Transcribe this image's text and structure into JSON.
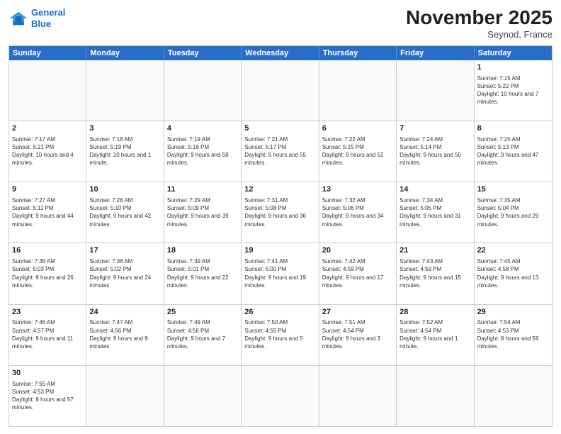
{
  "header": {
    "logo_general": "General",
    "logo_blue": "Blue",
    "month_title": "November 2025",
    "subtitle": "Seynod, France"
  },
  "days_of_week": [
    "Sunday",
    "Monday",
    "Tuesday",
    "Wednesday",
    "Thursday",
    "Friday",
    "Saturday"
  ],
  "weeks": [
    [
      {
        "day": "",
        "empty": true
      },
      {
        "day": "",
        "empty": true
      },
      {
        "day": "",
        "empty": true
      },
      {
        "day": "",
        "empty": true
      },
      {
        "day": "",
        "empty": true
      },
      {
        "day": "",
        "empty": true
      },
      {
        "day": "1",
        "sunrise": "Sunrise: 7:15 AM",
        "sunset": "Sunset: 5:22 PM",
        "daylight": "Daylight: 10 hours and 7 minutes."
      }
    ],
    [
      {
        "day": "2",
        "sunrise": "Sunrise: 7:17 AM",
        "sunset": "Sunset: 5:21 PM",
        "daylight": "Daylight: 10 hours and 4 minutes."
      },
      {
        "day": "3",
        "sunrise": "Sunrise: 7:18 AM",
        "sunset": "Sunset: 5:19 PM",
        "daylight": "Daylight: 10 hours and 1 minute."
      },
      {
        "day": "4",
        "sunrise": "Sunrise: 7:19 AM",
        "sunset": "Sunset: 5:18 PM",
        "daylight": "Daylight: 9 hours and 58 minutes."
      },
      {
        "day": "5",
        "sunrise": "Sunrise: 7:21 AM",
        "sunset": "Sunset: 5:17 PM",
        "daylight": "Daylight: 9 hours and 55 minutes."
      },
      {
        "day": "6",
        "sunrise": "Sunrise: 7:22 AM",
        "sunset": "Sunset: 5:15 PM",
        "daylight": "Daylight: 9 hours and 52 minutes."
      },
      {
        "day": "7",
        "sunrise": "Sunrise: 7:24 AM",
        "sunset": "Sunset: 5:14 PM",
        "daylight": "Daylight: 9 hours and 50 minutes."
      },
      {
        "day": "8",
        "sunrise": "Sunrise: 7:25 AM",
        "sunset": "Sunset: 5:13 PM",
        "daylight": "Daylight: 9 hours and 47 minutes."
      }
    ],
    [
      {
        "day": "9",
        "sunrise": "Sunrise: 7:27 AM",
        "sunset": "Sunset: 5:11 PM",
        "daylight": "Daylight: 9 hours and 44 minutes."
      },
      {
        "day": "10",
        "sunrise": "Sunrise: 7:28 AM",
        "sunset": "Sunset: 5:10 PM",
        "daylight": "Daylight: 9 hours and 42 minutes."
      },
      {
        "day": "11",
        "sunrise": "Sunrise: 7:29 AM",
        "sunset": "Sunset: 5:09 PM",
        "daylight": "Daylight: 9 hours and 39 minutes."
      },
      {
        "day": "12",
        "sunrise": "Sunrise: 7:31 AM",
        "sunset": "Sunset: 5:08 PM",
        "daylight": "Daylight: 9 hours and 36 minutes."
      },
      {
        "day": "13",
        "sunrise": "Sunrise: 7:32 AM",
        "sunset": "Sunset: 5:06 PM",
        "daylight": "Daylight: 9 hours and 34 minutes."
      },
      {
        "day": "14",
        "sunrise": "Sunrise: 7:34 AM",
        "sunset": "Sunset: 5:05 PM",
        "daylight": "Daylight: 9 hours and 31 minutes."
      },
      {
        "day": "15",
        "sunrise": "Sunrise: 7:35 AM",
        "sunset": "Sunset: 5:04 PM",
        "daylight": "Daylight: 9 hours and 29 minutes."
      }
    ],
    [
      {
        "day": "16",
        "sunrise": "Sunrise: 7:36 AM",
        "sunset": "Sunset: 5:03 PM",
        "daylight": "Daylight: 9 hours and 26 minutes."
      },
      {
        "day": "17",
        "sunrise": "Sunrise: 7:38 AM",
        "sunset": "Sunset: 5:02 PM",
        "daylight": "Daylight: 9 hours and 24 minutes."
      },
      {
        "day": "18",
        "sunrise": "Sunrise: 7:39 AM",
        "sunset": "Sunset: 5:01 PM",
        "daylight": "Daylight: 9 hours and 22 minutes."
      },
      {
        "day": "19",
        "sunrise": "Sunrise: 7:41 AM",
        "sunset": "Sunset: 5:00 PM",
        "daylight": "Daylight: 9 hours and 19 minutes."
      },
      {
        "day": "20",
        "sunrise": "Sunrise: 7:42 AM",
        "sunset": "Sunset: 4:59 PM",
        "daylight": "Daylight: 9 hours and 17 minutes."
      },
      {
        "day": "21",
        "sunrise": "Sunrise: 7:43 AM",
        "sunset": "Sunset: 4:59 PM",
        "daylight": "Daylight: 9 hours and 15 minutes."
      },
      {
        "day": "22",
        "sunrise": "Sunrise: 7:45 AM",
        "sunset": "Sunset: 4:58 PM",
        "daylight": "Daylight: 9 hours and 13 minutes."
      }
    ],
    [
      {
        "day": "23",
        "sunrise": "Sunrise: 7:46 AM",
        "sunset": "Sunset: 4:57 PM",
        "daylight": "Daylight: 9 hours and 11 minutes."
      },
      {
        "day": "24",
        "sunrise": "Sunrise: 7:47 AM",
        "sunset": "Sunset: 4:56 PM",
        "daylight": "Daylight: 9 hours and 9 minutes."
      },
      {
        "day": "25",
        "sunrise": "Sunrise: 7:49 AM",
        "sunset": "Sunset: 4:56 PM",
        "daylight": "Daylight: 9 hours and 7 minutes."
      },
      {
        "day": "26",
        "sunrise": "Sunrise: 7:50 AM",
        "sunset": "Sunset: 4:55 PM",
        "daylight": "Daylight: 9 hours and 5 minutes."
      },
      {
        "day": "27",
        "sunrise": "Sunrise: 7:51 AM",
        "sunset": "Sunset: 4:54 PM",
        "daylight": "Daylight: 9 hours and 3 minutes."
      },
      {
        "day": "28",
        "sunrise": "Sunrise: 7:52 AM",
        "sunset": "Sunset: 4:54 PM",
        "daylight": "Daylight: 9 hours and 1 minute."
      },
      {
        "day": "29",
        "sunrise": "Sunrise: 7:54 AM",
        "sunset": "Sunset: 4:53 PM",
        "daylight": "Daylight: 8 hours and 59 minutes."
      }
    ],
    [
      {
        "day": "30",
        "sunrise": "Sunrise: 7:55 AM",
        "sunset": "Sunset: 4:53 PM",
        "daylight": "Daylight: 8 hours and 57 minutes."
      },
      {
        "day": "",
        "empty": true
      },
      {
        "day": "",
        "empty": true
      },
      {
        "day": "",
        "empty": true
      },
      {
        "day": "",
        "empty": true
      },
      {
        "day": "",
        "empty": true
      },
      {
        "day": "",
        "empty": true
      }
    ]
  ]
}
